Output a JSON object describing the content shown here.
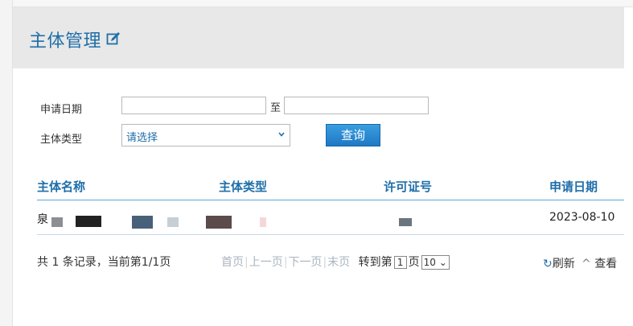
{
  "header": {
    "title": "主体管理"
  },
  "filters": {
    "date_label": "申请日期",
    "date_from": "",
    "date_separator": "至",
    "date_to": "",
    "type_label": "主体类型",
    "type_selected": "请选择",
    "query_label": "查询"
  },
  "table": {
    "columns": [
      "主体名称",
      "主体类型",
      "许可证号",
      "申请日期"
    ],
    "rows": [
      {
        "name": "泉",
        "type": "",
        "license": "",
        "date": "2023-08-10"
      }
    ]
  },
  "pager": {
    "summary": "共 1 条记录，当前第1/1页",
    "first": "首页",
    "prev": "上一页",
    "next": "下一页",
    "last": "末页",
    "goto_prefix": "转到第",
    "page_value": "1",
    "goto_suffix": "页",
    "page_size": "10",
    "refresh_label": "刷新",
    "view_label": "查看"
  },
  "colors": {
    "accent": "#1f6ea8",
    "button": "#2a86d2",
    "header_bg": "#e8e8e8"
  }
}
